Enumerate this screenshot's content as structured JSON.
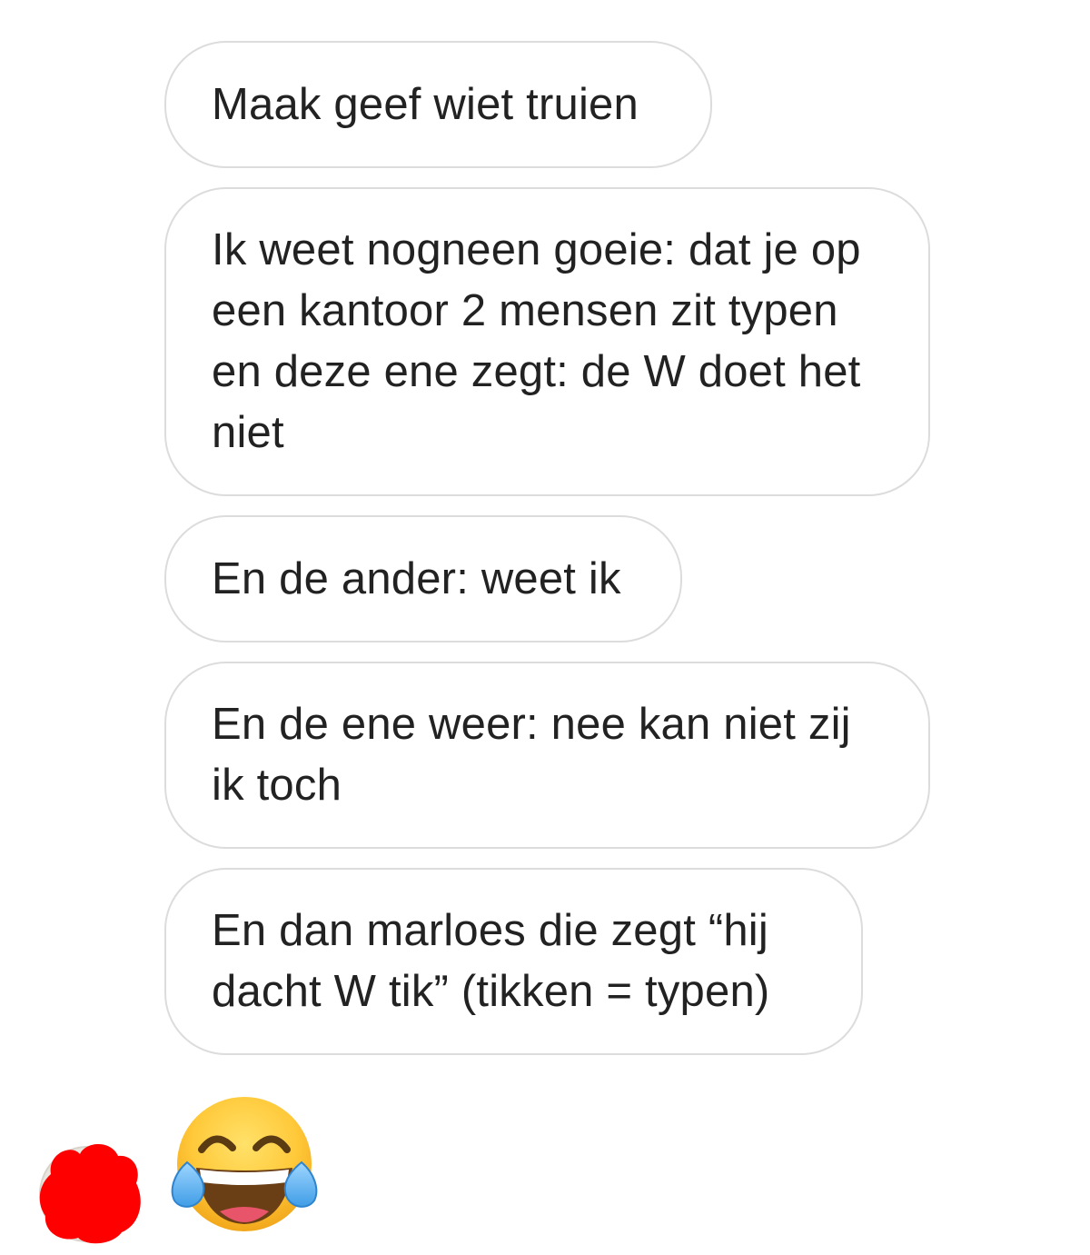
{
  "conversation": {
    "messages": [
      {
        "text": "Maak geef wiet truien"
      },
      {
        "text": "Ik weet nogneen goeie: dat je op een kantoor 2 mensen zit typen en deze ene zegt: de W doet het niet"
      },
      {
        "text": "En de ander: weet ik"
      },
      {
        "text": "En de ene weer: nee kan niet zij ik toch"
      },
      {
        "text": "En dan marloes die zegt “hij dacht W tik” (tikken = typen)"
      }
    ],
    "reaction": {
      "icon": "face-with-tears-of-joy-emoji"
    },
    "sender_avatar": {
      "icon": "redacted-avatar",
      "color": "#ff0000"
    }
  },
  "colors": {
    "bubble_border": "#dcdcdc",
    "text": "#222222",
    "background": "#ffffff"
  }
}
